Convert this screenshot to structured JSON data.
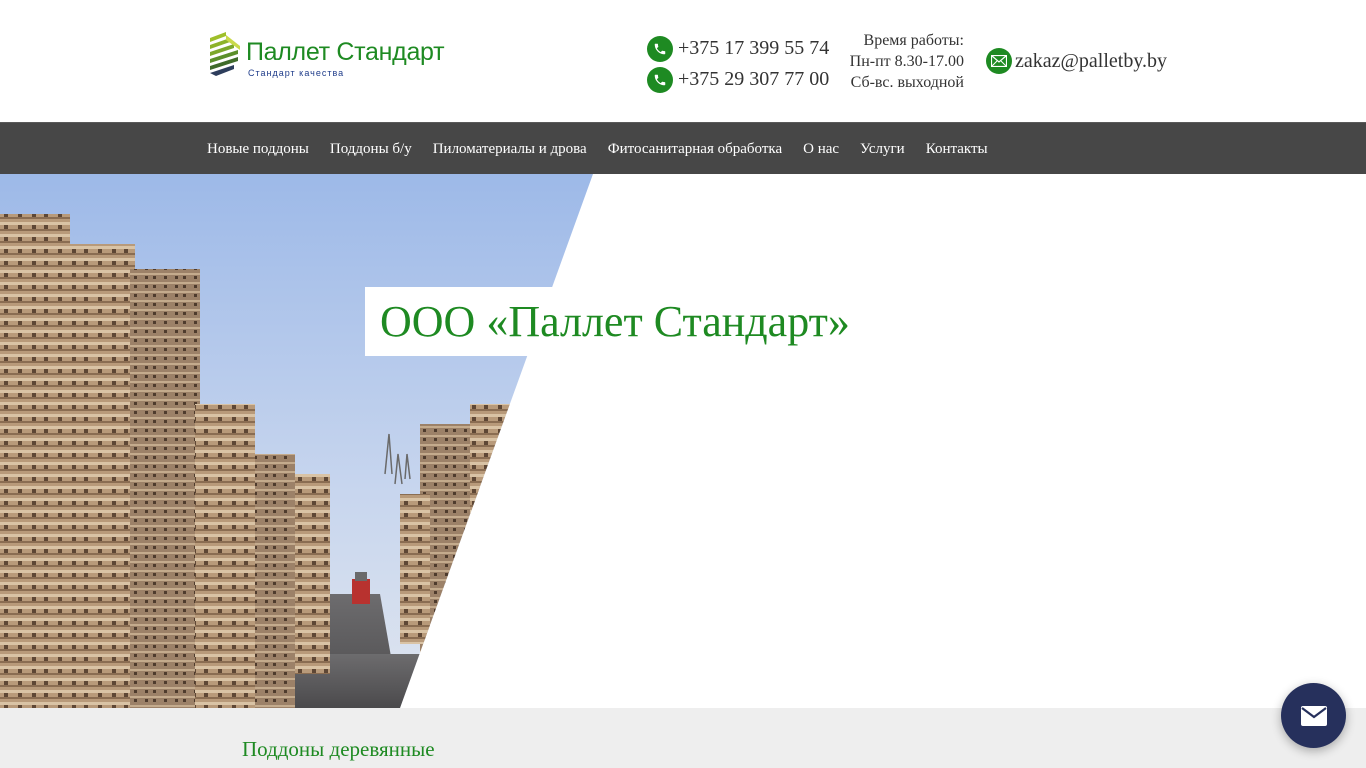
{
  "brand": {
    "name": "Паллет Стандарт",
    "tagline": "Стандарт качества"
  },
  "contacts": {
    "phones": [
      "+375 17 399 55 74",
      "+375 29 307 77 00"
    ],
    "hours": {
      "title": "Время работы:",
      "weekdays": "Пн-пт 8.30-17.00",
      "weekend": "Сб-вс. выходной"
    },
    "email": "zakaz@palletby.by"
  },
  "nav": {
    "items": [
      {
        "label": "Новые поддоны"
      },
      {
        "label": "Поддоны б/у"
      },
      {
        "label": "Пиломатериалы и дрова"
      },
      {
        "label": "Фитосанитарная обработка"
      },
      {
        "label": "О нас"
      },
      {
        "label": "Услуги"
      },
      {
        "label": "Контакты"
      }
    ]
  },
  "hero": {
    "title": "ООО «Паллет Стандарт»"
  },
  "section": {
    "title": "Поддоны деревянные"
  },
  "colors": {
    "brand_green": "#1e8a22",
    "nav_bg": "#474747",
    "section_bg": "#eeeeee",
    "fab_bg": "#26305c"
  },
  "icons": {
    "phone": "phone-icon",
    "email": "envelope-icon",
    "fab": "envelope-icon"
  }
}
